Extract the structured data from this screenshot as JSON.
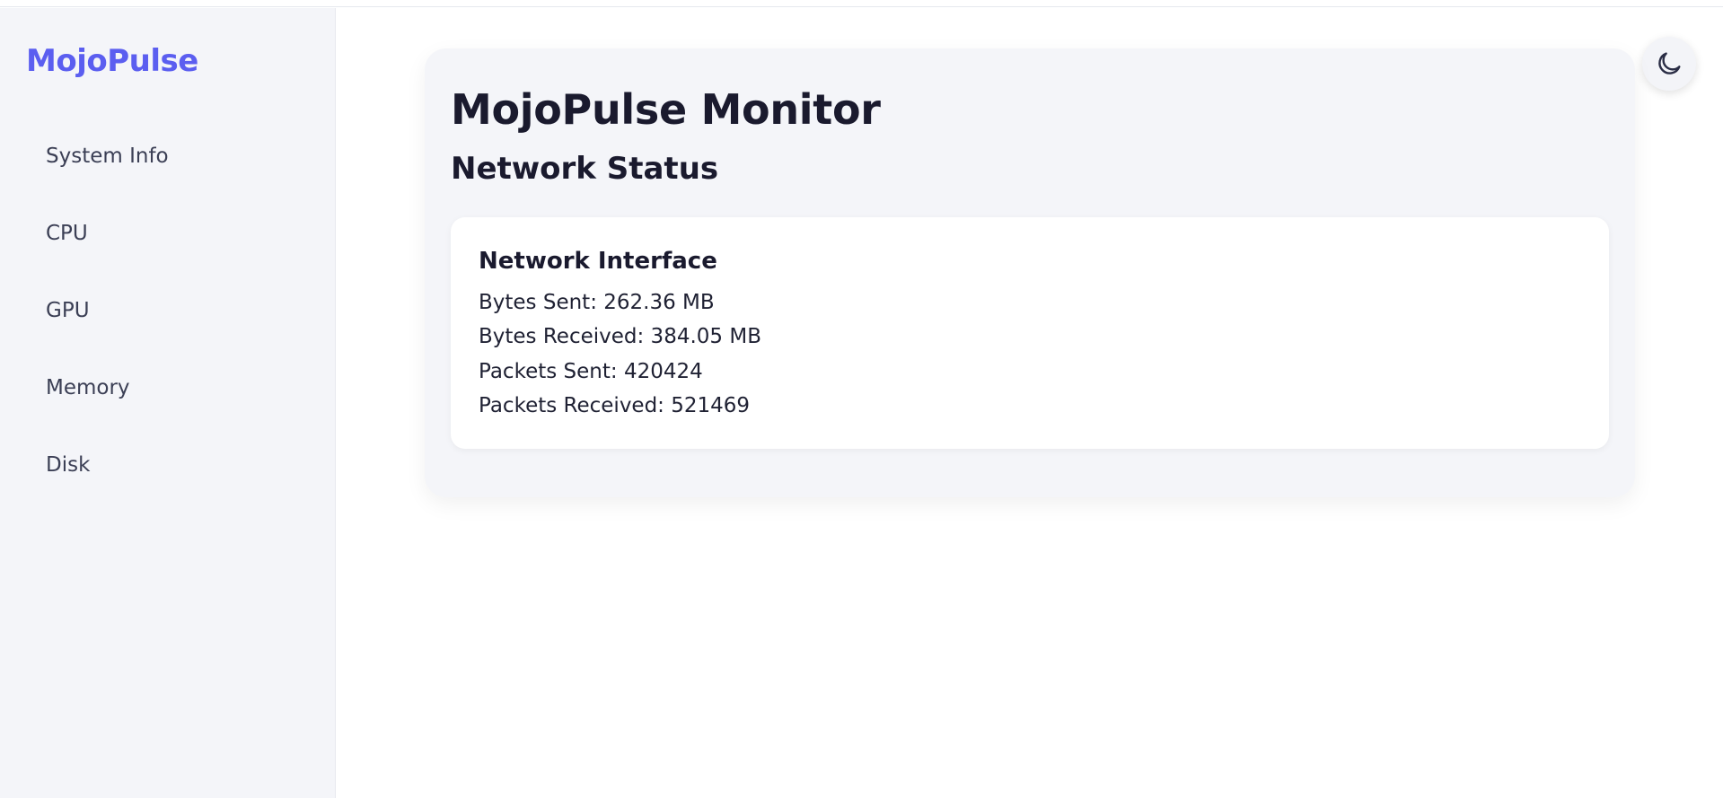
{
  "brand": "MojoPulse",
  "sidebar": {
    "items": [
      {
        "label": "System Info"
      },
      {
        "label": "CPU"
      },
      {
        "label": "GPU"
      },
      {
        "label": "Memory"
      },
      {
        "label": "Disk"
      }
    ]
  },
  "theme_toggle": {
    "icon": "moon-icon"
  },
  "main": {
    "title": "MojoPulse Monitor",
    "section_title": "Network Status",
    "card": {
      "title": "Network Interface",
      "stats": [
        "Bytes Sent: 262.36 MB",
        "Bytes Received: 384.05 MB",
        "Packets Sent: 420424",
        "Packets Received: 521469"
      ]
    }
  },
  "colors": {
    "accent": "#5b5ef0",
    "sidebar_bg": "#f4f5f9",
    "text_primary": "#1a1a2e"
  }
}
